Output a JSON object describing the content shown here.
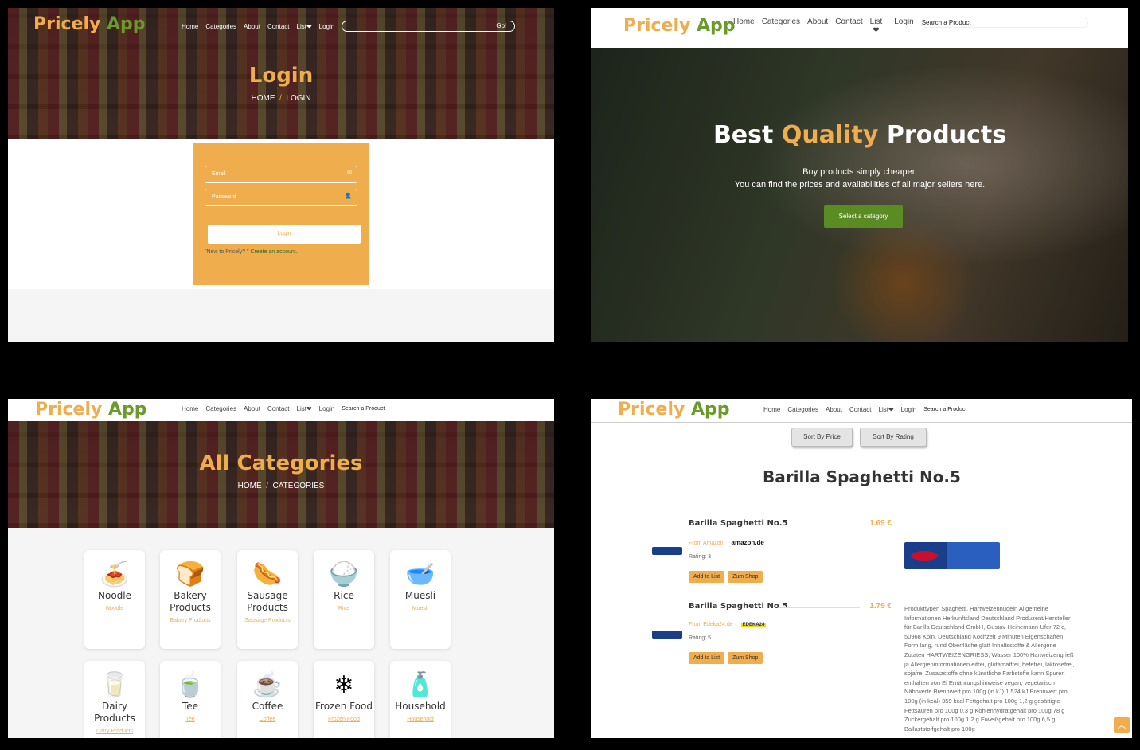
{
  "brand": {
    "part1": "Pricely",
    "part2": "App"
  },
  "nav": {
    "home": "Home",
    "categories": "Categories",
    "about": "About",
    "contact": "Contact",
    "list": "List❤",
    "login": "Login",
    "search_placeholder": "Search a Product",
    "go": "Go!"
  },
  "login_page": {
    "title": "Login",
    "crumb_home": "HOME",
    "crumb_sep": "/",
    "crumb_current": "LOGIN",
    "email_placeholder": "Email",
    "password_placeholder": "Password",
    "button": "Login",
    "new_prefix": "\"New to Pricely? \"",
    "create_link": "Create an account."
  },
  "home_page": {
    "title_a": "Best",
    "title_b": "Quality",
    "title_c": "Products",
    "line1": "Buy products simply cheaper.",
    "line2": "You can find the prices and availabilities of all major sellers here.",
    "cta": "Select a category",
    "list_label": "List",
    "heart": "❤"
  },
  "categories_page": {
    "title": "All Categories",
    "crumb_home": "HOME",
    "crumb_sep": "/",
    "crumb_current": "CATEGORIES",
    "items": [
      {
        "name": "Noodle",
        "link": "Noodle",
        "icon": "noodle-icon",
        "glyph": "🍝"
      },
      {
        "name": "Bakery Products",
        "link": "Bakery Products",
        "icon": "bread-icon",
        "glyph": "🍞"
      },
      {
        "name": "Sausage Products",
        "link": "Sausage Products",
        "icon": "sausage-icon",
        "glyph": "🌭"
      },
      {
        "name": "Rice",
        "link": "Rice",
        "icon": "rice-icon",
        "glyph": "🍚"
      },
      {
        "name": "Muesli",
        "link": "Muesli",
        "icon": "muesli-icon",
        "glyph": "🥣"
      },
      {
        "name": "Dairy Products",
        "link": "Dairy Products",
        "icon": "dairy-icon",
        "glyph": "🥛"
      },
      {
        "name": "Tee",
        "link": "Tee",
        "icon": "tea-icon",
        "glyph": "🍵"
      },
      {
        "name": "Coffee",
        "link": "Coffee",
        "icon": "coffee-icon",
        "glyph": "☕"
      },
      {
        "name": "Frozen Food",
        "link": "Frozen Food",
        "icon": "frozen-food-icon",
        "glyph": "❄"
      },
      {
        "name": "Household",
        "link": "Household",
        "icon": "household-icon",
        "glyph": "🧴"
      }
    ]
  },
  "product_page": {
    "sort_price": "Sort By Price",
    "sort_rating": "Sort By Rating",
    "title": "Barilla Spaghetti No.5",
    "offers": [
      {
        "name": "Barilla Spaghetti No.5",
        "price": "1.69 €",
        "from": "From Amazon",
        "seller_logo": "amazon.de",
        "rating": "Rating: 3",
        "add": "Add to List",
        "shop": "Zum Shop"
      },
      {
        "name": "Barilla Spaghetti No.5",
        "price": "1.79 €",
        "from": "From Edeka24.de",
        "seller_logo": "EDEKA24",
        "rating": "Rating: 5",
        "add": "Add to List",
        "shop": "Zum Shop"
      }
    ],
    "description": "Produkttypen Spaghetti, Hartweizennudeln Allgemeine Informationen Herkunftsland Deutschland Produzent/Hersteller für Barilla Deutschland GmbH, Gustav-Heinemann-Ufer 72 c, 50968 Köln, Deutschland Kochzeit 9 Minuten Eigenschaften Form lang, rund Oberfläche glatt Inhaltsstoffe & Allergene Zutaten HARTWEIZENGRIESS, Wasser 100% Hartweizengrieß ja Allergieninformationen eifrei, glutamatfrei, hefefrei, laktosefrei, sojafrei Zusatzstoffe ohne künstliche Farbstoffe kann Spuren enthalten von Ei Ernährungshinweise vegan, vegetarisch Nährwerte Brennwert pro 100g (in kJ) 1.524 kJ Brennwert pro 100g (in kcal) 359 kcal Fettgehalt pro 100g 1,2 g gesättigte Fettsäuren pro 100g 0,3 g Kohlenhydratgehalt pro 100g 78 g Zuckergehalt pro 100g 1,2 g Eiweißgehalt pro 100g 6,5 g Ballaststoffgehalt pro 100g"
  }
}
